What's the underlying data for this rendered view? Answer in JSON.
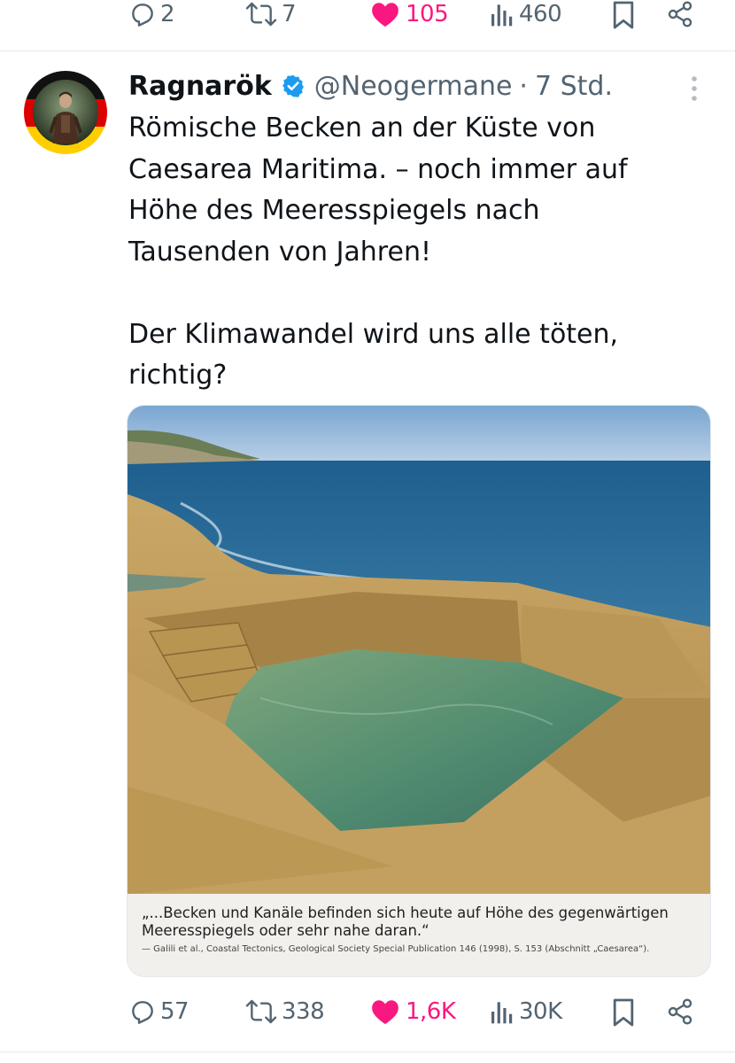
{
  "top_actions": {
    "replies": "2",
    "reposts": "7",
    "likes": "105",
    "views": "460"
  },
  "tweet": {
    "display_name": "Ragnarök",
    "handle": "@Neogermane",
    "separator": "·",
    "time": "7 Std.",
    "text": "Römische Becken an der Küste von\nCaesarea Maritima. – noch immer auf\nHöhe des Meeresspiegels nach\nTausenden von Jahren!\n\nDer Klimawandel wird uns alle töten,\nrichtig?",
    "media": {
      "quote": "„...Becken und Kanäle befinden sich heute auf Höhe des gegenwärtigen Meeresspiegels oder sehr nahe daran.“",
      "source": "— Galili et al., Coastal Tectonics, Geological Society Special Publication 146 (1998), S. 153 (Abschnitt „Caesarea“)."
    },
    "actions": {
      "replies": "57",
      "reposts": "338",
      "likes": "1,6K",
      "views": "30K"
    }
  },
  "colors": {
    "text_primary": "#0f1419",
    "text_secondary": "#536471",
    "like": "#f91880",
    "verified": "#1d9bf0",
    "divider": "#e7e9ea"
  },
  "icons": [
    "reply-icon",
    "repost-icon",
    "like-icon",
    "views-icon",
    "bookmark-icon",
    "share-icon",
    "verified-icon",
    "more-icon"
  ]
}
